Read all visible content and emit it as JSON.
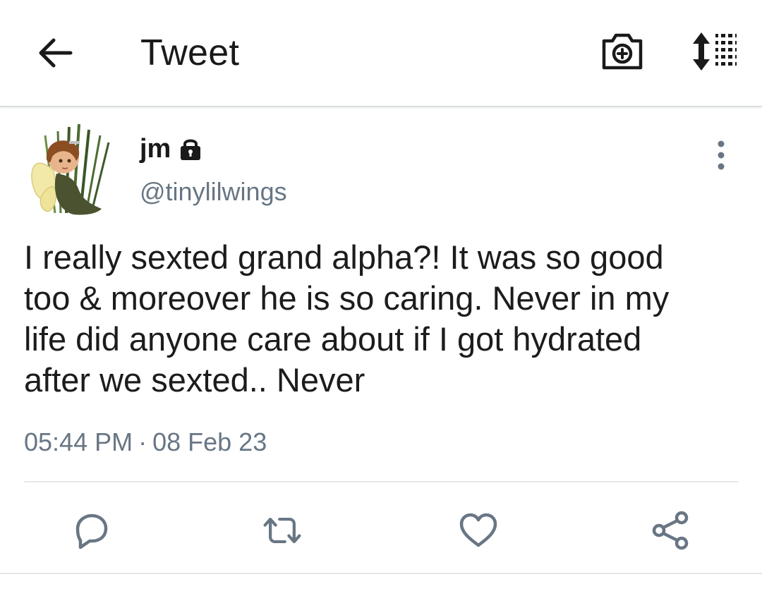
{
  "topbar": {
    "title": "Tweet",
    "back_icon": "arrow-left-icon",
    "camera_icon": "camera-plus-icon",
    "sort_icon": "sort-list-icon"
  },
  "tweet": {
    "author": {
      "display_name": "jm",
      "handle": "@tinylilwings",
      "protected_icon": "lock-icon",
      "avatar": "fairy-avatar"
    },
    "text": "I really sexted grand alpha?! It was so good\ntoo & moreover he is so caring. Never in my\nlife did anyone care about if I got hydrated\nafter we sexted.. Never",
    "time": "05:44 PM",
    "separator": "·",
    "date": "08 Feb 23"
  },
  "actions": {
    "reply_icon": "reply-icon",
    "retweet_icon": "retweet-icon",
    "like_icon": "heart-icon",
    "share_icon": "share-icon"
  },
  "colors": {
    "icon": "#687684",
    "text": "#1c1c1c",
    "muted": "#687684",
    "divider": "#e3e7ea"
  }
}
